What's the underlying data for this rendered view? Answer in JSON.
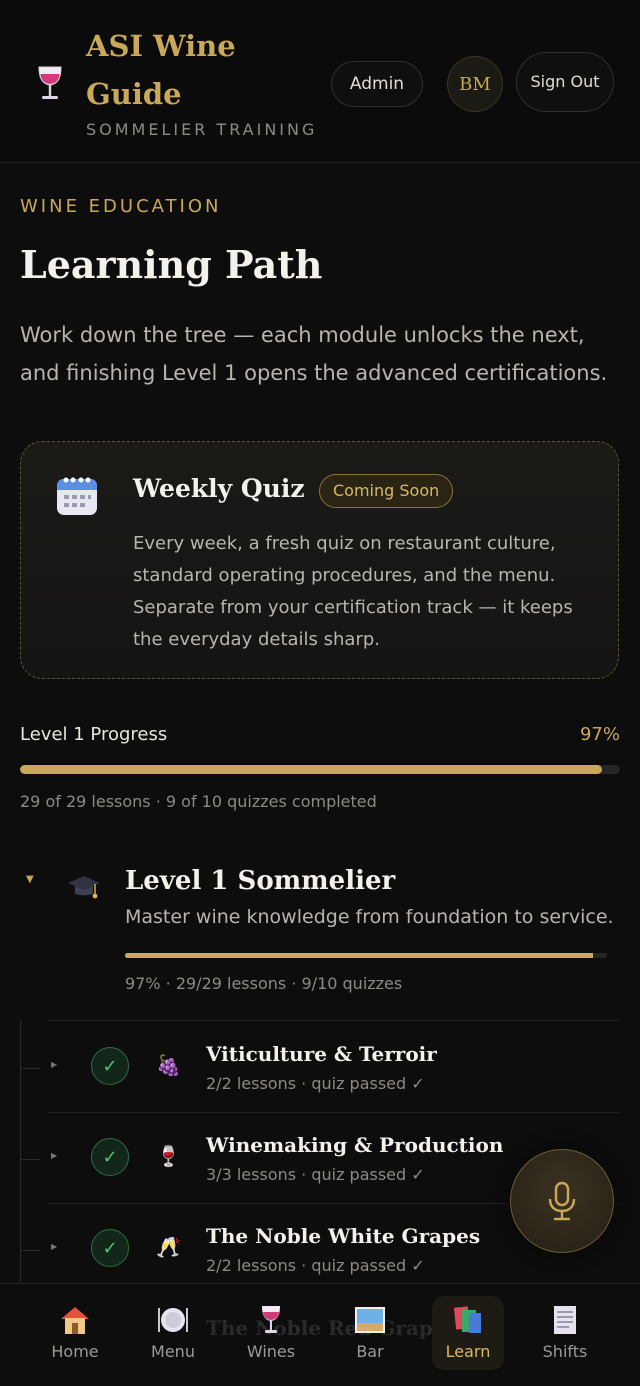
{
  "header": {
    "brand_title": "ASI Wine Guide",
    "brand_subtitle": "SOMMELIER TRAINING",
    "admin_label": "Admin",
    "avatar_initials": "BM",
    "sign_out_label": "Sign Out"
  },
  "intro": {
    "kicker": "WINE EDUCATION",
    "title": "Learning Path",
    "description": "Work down the tree — each module unlocks the next, and finishing Level 1 opens the advanced certifications."
  },
  "quiz_card": {
    "icon": "calendar-icon",
    "title": "Weekly Quiz",
    "badge": "Coming Soon",
    "description": "Every week, a fresh quiz on restaurant culture, standard operating procedures, and the menu. Separate from your certification track — it keeps the everyday details sharp."
  },
  "progress": {
    "label": "Level 1 Progress",
    "percent_text": "97%",
    "percent": 97,
    "meta": "29 of 29 lessons · 9 of 10 quizzes completed"
  },
  "level": {
    "icon": "graduation-cap-icon",
    "title": "Level 1 Sommelier",
    "subtitle": "Master wine knowledge from foundation to service.",
    "percent": 97,
    "meta": "97% · 29/29 lessons · 9/10 quizzes"
  },
  "modules": [
    {
      "icon": "grapes-icon",
      "glyph": "🍇",
      "title": "Viticulture & Terroir",
      "meta": "2/2 lessons · quiz passed ✓"
    },
    {
      "icon": "wine-glass-icon",
      "glyph": "🍷",
      "title": "Winemaking & Production",
      "meta": "3/3 lessons · quiz passed ✓"
    },
    {
      "icon": "clinking-glasses-icon",
      "glyph": "🥂",
      "title": "The Noble White Grapes",
      "meta": "2/2 lessons · quiz passed ✓"
    }
  ],
  "ghost_module_title": "The Noble Red Grapes",
  "mic": {
    "icon": "microphone-icon"
  },
  "nav": [
    {
      "label": "Home",
      "icon": "house-icon"
    },
    {
      "label": "Menu",
      "icon": "plate-icon"
    },
    {
      "label": "Wines",
      "icon": "wine-glass-icon"
    },
    {
      "label": "Bar",
      "icon": "bar-icon"
    },
    {
      "label": "Learn",
      "icon": "books-icon",
      "active": true
    },
    {
      "label": "Shifts",
      "icon": "schedule-icon"
    }
  ],
  "colors": {
    "accent": "#c9a85a",
    "success": "#52c27a",
    "background": "#0d0d0d"
  }
}
